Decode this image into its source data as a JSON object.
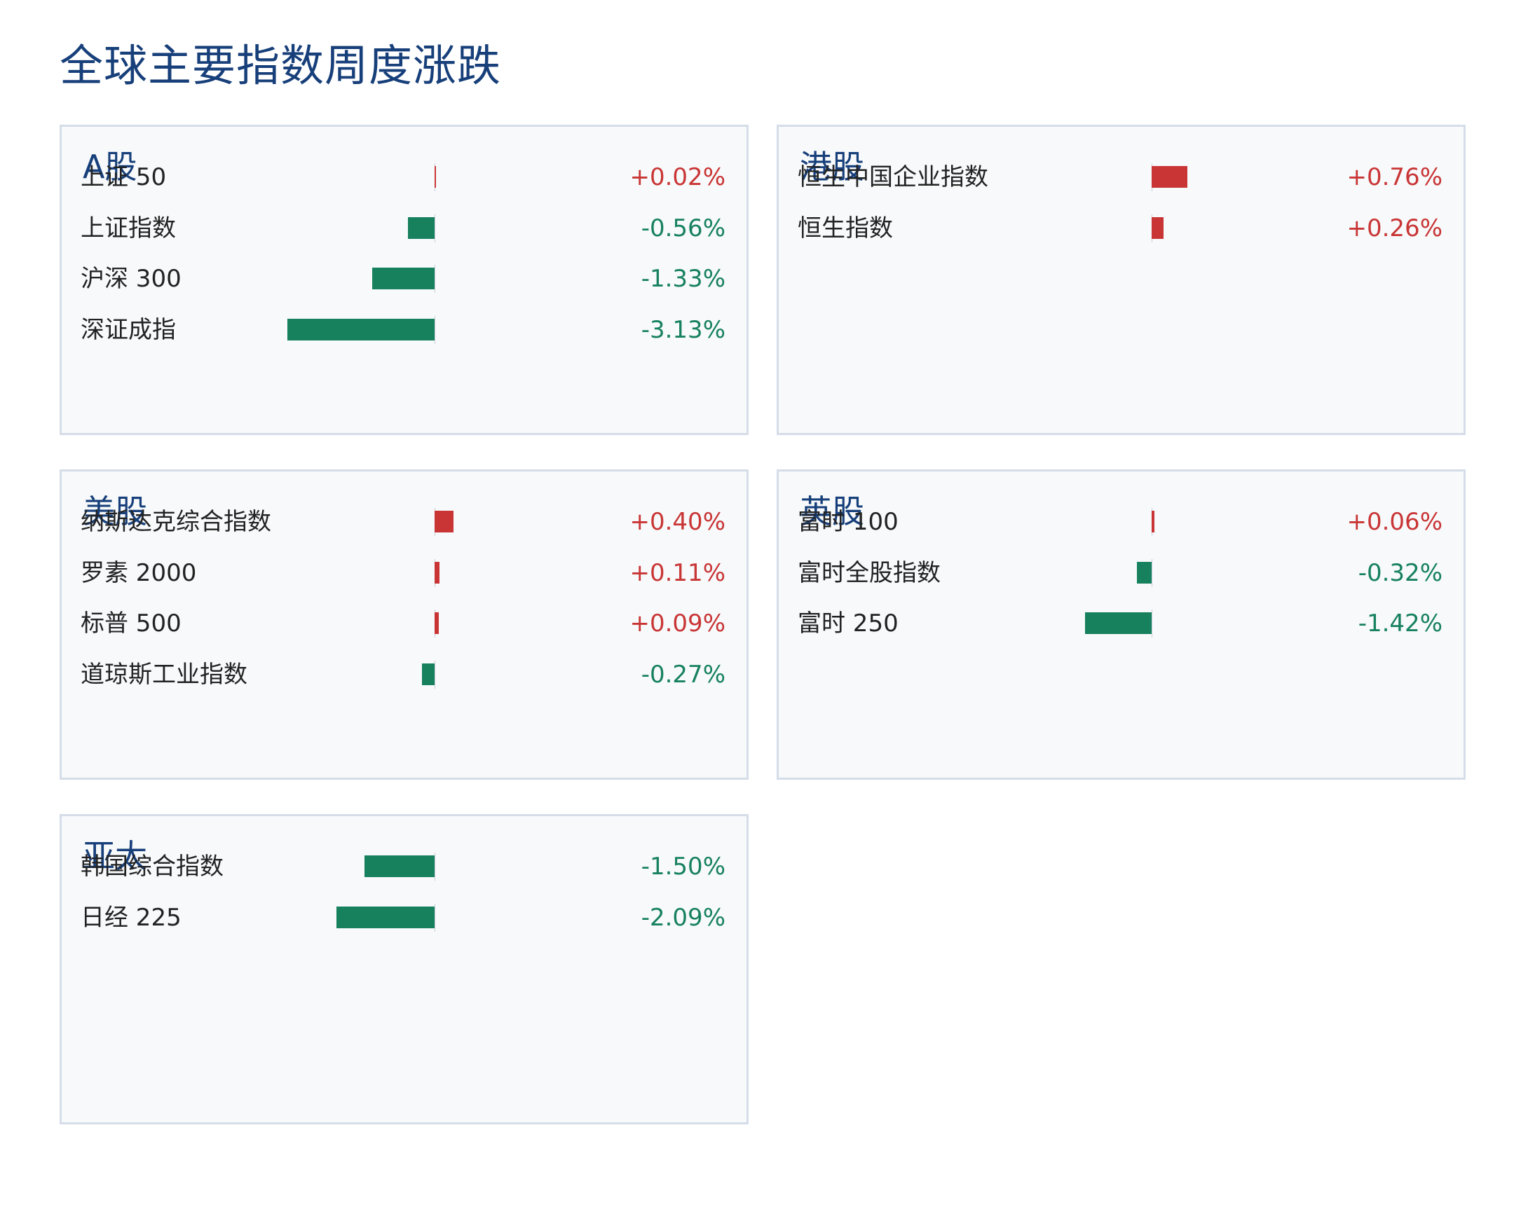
{
  "title": "全球主要指数周度涨跌",
  "colors": {
    "up": "#c93535",
    "down": "#17815e",
    "title": "#173f7a",
    "panel_bg": "#f7f9fb",
    "panel_border": "#d5dde8"
  },
  "chart_data": [
    {
      "type": "bar",
      "title": "A股",
      "categories": [
        "上证 50",
        "上证指数",
        "沪深 300",
        "深证成指"
      ],
      "values": [
        0.02,
        -0.56,
        -1.33,
        -3.13
      ],
      "labels": [
        "+0.02%",
        "-0.56%",
        "-1.33%",
        "-3.13%"
      ]
    },
    {
      "type": "bar",
      "title": "港股",
      "categories": [
        "恒生中国企业指数",
        "恒生指数"
      ],
      "values": [
        0.76,
        0.26
      ],
      "labels": [
        "+0.76%",
        "+0.26%"
      ]
    },
    {
      "type": "bar",
      "title": "美股",
      "categories": [
        "纳斯达克综合指数",
        "罗素 2000",
        "标普 500",
        "道琼斯工业指数"
      ],
      "values": [
        0.4,
        0.11,
        0.09,
        -0.27
      ],
      "labels": [
        "+0.40%",
        "+0.11%",
        "+0.09%",
        "-0.27%"
      ]
    },
    {
      "type": "bar",
      "title": "英股",
      "categories": [
        "富时 100",
        "富时全股指数",
        "富时 250"
      ],
      "values": [
        0.06,
        -0.32,
        -1.42
      ],
      "labels": [
        "+0.06%",
        "-0.32%",
        "-1.42%"
      ]
    },
    {
      "type": "bar",
      "title": "亚太",
      "categories": [
        "韩国综合指数",
        "日经 225"
      ],
      "values": [
        -1.5,
        -2.09
      ],
      "labels": [
        "-1.50%",
        "-2.09%"
      ]
    }
  ]
}
